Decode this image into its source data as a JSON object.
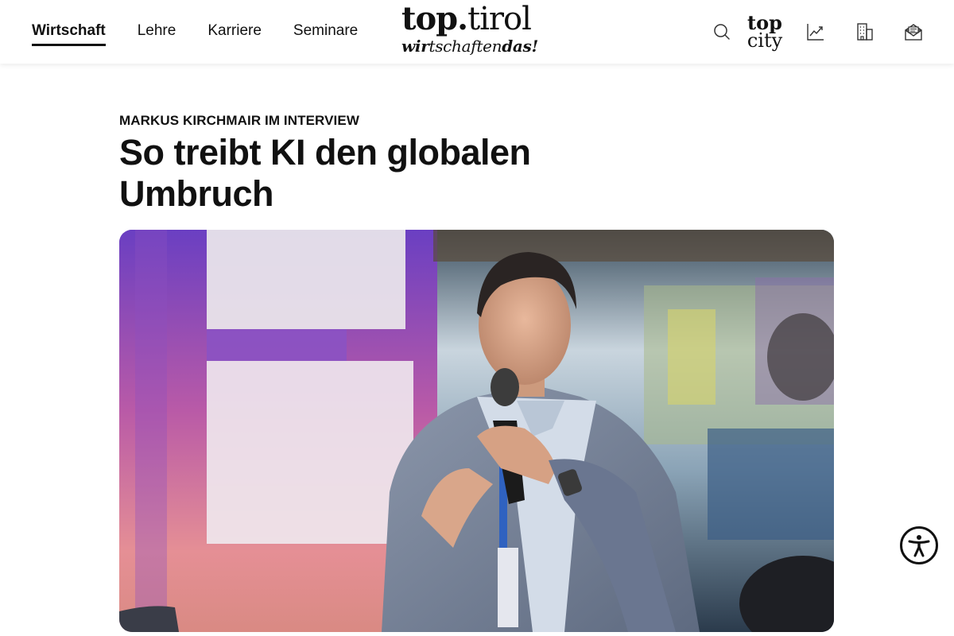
{
  "nav": {
    "items": [
      {
        "label": "Wirtschaft",
        "active": true
      },
      {
        "label": "Lehre",
        "active": false
      },
      {
        "label": "Karriere",
        "active": false
      },
      {
        "label": "Seminare",
        "active": false
      }
    ]
  },
  "logo": {
    "top_bold": "top.",
    "top_regular": "tirol",
    "sub_bold_1": "wir",
    "sub_regular": "tschaften",
    "sub_bold_2": "das!"
  },
  "tools": {
    "search_icon": "search-icon",
    "topcity_line1": "top",
    "topcity_line2": "city",
    "chart_icon": "trend-chart-icon",
    "building_icon": "building-icon",
    "newsletter_icon": "newsletter-icon"
  },
  "article": {
    "kicker": "MARKUS KIRCHMAIR IM INTERVIEW",
    "headline": "So treibt KI den globalen Umbruch",
    "hero_image": "speaker-with-microphone-photo"
  },
  "accessibility": {
    "icon": "accessibility-icon"
  },
  "colors": {
    "text": "#111111",
    "background": "#ffffff"
  }
}
